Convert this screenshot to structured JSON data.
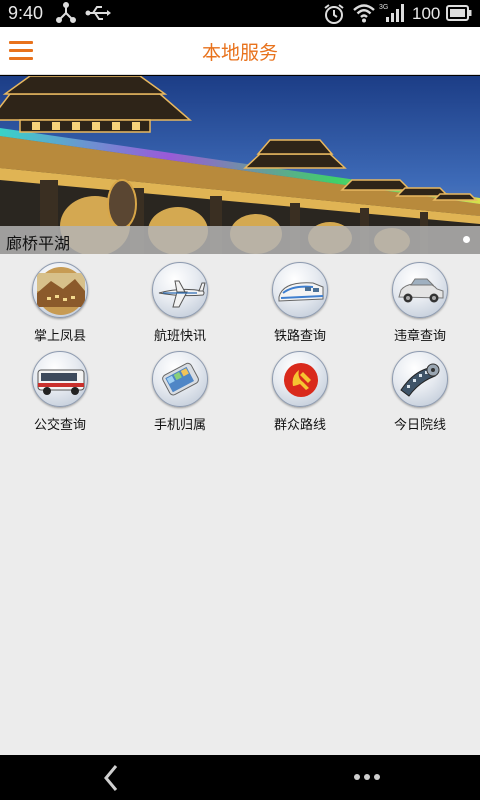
{
  "status_bar": {
    "time": "9:40",
    "battery_level": "100",
    "network": "3G",
    "icons": [
      "usb-share-icon",
      "usb-icon",
      "alarm-icon",
      "wifi-icon",
      "signal-icon",
      "battery-icon"
    ]
  },
  "header": {
    "title": "本地服务",
    "menu_icon": "hamburger-menu-icon",
    "accent_color": "#e8721c"
  },
  "banner": {
    "caption": "廊桥平湖",
    "page_indicator": {
      "count": 1,
      "active": 0
    }
  },
  "services": [
    {
      "label": "掌上凤县",
      "icon": "mountain-town-icon"
    },
    {
      "label": "航班快讯",
      "icon": "airplane-icon"
    },
    {
      "label": "铁路查询",
      "icon": "train-icon"
    },
    {
      "label": "违章查询",
      "icon": "car-icon"
    },
    {
      "label": "公交查询",
      "icon": "bus-icon"
    },
    {
      "label": "手机归属",
      "icon": "mobile-phone-icon"
    },
    {
      "label": "群众路线",
      "icon": "party-emblem-icon"
    },
    {
      "label": "今日院线",
      "icon": "film-reel-icon"
    }
  ],
  "nav_bar": {
    "back_icon": "back-arrow-icon",
    "more_icon": "more-dots-icon"
  }
}
